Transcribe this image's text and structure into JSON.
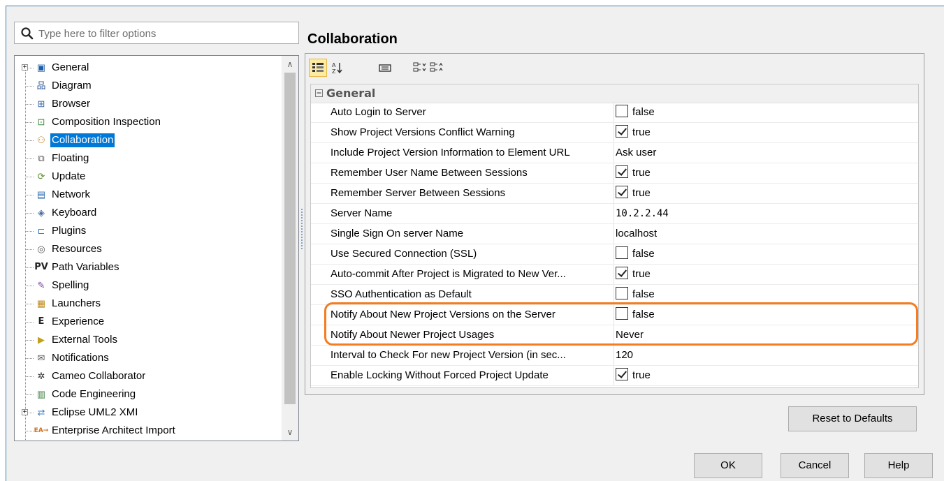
{
  "search": {
    "placeholder": "Type here to filter options"
  },
  "tree": {
    "items": [
      {
        "label": "General",
        "icon": "general-icon",
        "expandable": true,
        "expander": "+",
        "selected": false
      },
      {
        "label": "Diagram",
        "icon": "diagram-icon",
        "expandable": false,
        "selected": false
      },
      {
        "label": "Browser",
        "icon": "browser-icon",
        "expandable": false,
        "selected": false
      },
      {
        "label": "Composition Inspection",
        "icon": "composition-inspection-icon",
        "expandable": false,
        "selected": false
      },
      {
        "label": "Collaboration",
        "icon": "collaboration-icon",
        "expandable": false,
        "selected": true
      },
      {
        "label": "Floating",
        "icon": "floating-icon",
        "expandable": false,
        "selected": false
      },
      {
        "label": "Update",
        "icon": "update-icon",
        "expandable": false,
        "selected": false
      },
      {
        "label": "Network",
        "icon": "network-icon",
        "expandable": false,
        "selected": false
      },
      {
        "label": "Keyboard",
        "icon": "keyboard-icon",
        "expandable": false,
        "selected": false
      },
      {
        "label": "Plugins",
        "icon": "plugins-icon",
        "expandable": false,
        "selected": false
      },
      {
        "label": "Resources",
        "icon": "resources-icon",
        "expandable": false,
        "selected": false
      },
      {
        "label": "Path Variables",
        "icon": "path-variables-icon",
        "icon_text": "PV",
        "expandable": false,
        "selected": false
      },
      {
        "label": "Spelling",
        "icon": "spelling-icon",
        "expandable": false,
        "selected": false
      },
      {
        "label": "Launchers",
        "icon": "launchers-icon",
        "expandable": false,
        "selected": false
      },
      {
        "label": "Experience",
        "icon": "experience-icon",
        "icon_text": "E",
        "expandable": false,
        "selected": false
      },
      {
        "label": "External Tools",
        "icon": "external-tools-icon",
        "expandable": false,
        "selected": false
      },
      {
        "label": "Notifications",
        "icon": "notifications-icon",
        "expandable": false,
        "selected": false
      },
      {
        "label": "Cameo Collaborator",
        "icon": "cameo-collaborator-icon",
        "expandable": false,
        "selected": false
      },
      {
        "label": "Code Engineering",
        "icon": "code-engineering-icon",
        "expandable": false,
        "selected": false
      },
      {
        "label": "Eclipse UML2 XMI",
        "icon": "eclipse-uml2-xmi-icon",
        "expandable": true,
        "expander": "+",
        "selected": false
      },
      {
        "label": "Enterprise Architect Import",
        "icon": "enterprise-architect-import-icon",
        "icon_text": "EA→",
        "expandable": false,
        "selected": false
      }
    ]
  },
  "panel": {
    "title": "Collaboration",
    "group": {
      "expander": "−",
      "label": "General"
    },
    "properties": [
      {
        "name": "Auto Login to Server",
        "type": "checkbox",
        "checked": false,
        "value": "false"
      },
      {
        "name": "Show Project Versions Conflict Warning",
        "type": "checkbox",
        "checked": true,
        "value": "true"
      },
      {
        "name": "Include Project Version Information to Element URL",
        "type": "text",
        "value": "Ask user"
      },
      {
        "name": "Remember User Name Between Sessions",
        "type": "checkbox",
        "checked": true,
        "value": "true"
      },
      {
        "name": "Remember Server Between Sessions",
        "type": "checkbox",
        "checked": true,
        "value": "true"
      },
      {
        "name": "Server Name",
        "type": "mono",
        "value": "10.2.2.44"
      },
      {
        "name": "Single Sign On server Name",
        "type": "text",
        "value": "localhost"
      },
      {
        "name": "Use Secured Connection (SSL)",
        "type": "checkbox",
        "checked": false,
        "value": "false"
      },
      {
        "name": "Auto-commit After Project is Migrated to New Ver...",
        "type": "checkbox",
        "checked": true,
        "value": "true"
      },
      {
        "name": "SSO Authentication as Default",
        "type": "checkbox",
        "checked": false,
        "value": "false"
      },
      {
        "name": "Notify About New Project Versions on the Server",
        "type": "checkbox",
        "checked": false,
        "value": "false"
      },
      {
        "name": "Notify About Newer Project Usages",
        "type": "text",
        "value": "Never"
      },
      {
        "name": "Interval to Check For new Project Version (in sec...",
        "type": "text",
        "value": "120"
      },
      {
        "name": "Enable Locking Without Forced Project Update",
        "type": "checkbox",
        "checked": true,
        "value": "true"
      }
    ]
  },
  "buttons": {
    "reset": "Reset to Defaults",
    "ok": "OK",
    "cancel": "Cancel",
    "help": "Help"
  },
  "colors": {
    "selection": "#0078d7",
    "highlight_outline": "#f57c1f",
    "window_border": "#3c7fb1"
  }
}
